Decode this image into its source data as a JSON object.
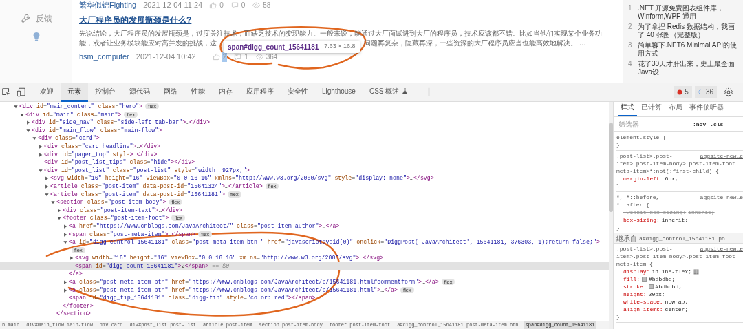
{
  "page": {
    "sidebar": {
      "items": [
        {
          "kind": "wrench",
          "label": "反馈"
        },
        {
          "kind": "bulb"
        }
      ]
    },
    "posts": [
      {
        "author": "繁华似锦Fighting",
        "date": "2021-12-04 11:24",
        "likes": "0",
        "comments": "0",
        "views": "58",
        "inspected": false
      },
      {
        "title": "大厂程序员的发展瓶颈是什么?",
        "excerpt_lines": [
          [
            "先说结论，大厂程序员的发展瓶颈是，过度关注技术，而缺乏技术的变现能力。一般来说，能通过大厂面试进到大厂的程序员，技术应该都不错。比如当他们实现某个业务功"
          ],
          [
            "能，或者让业务模块能应对高并发的挑战，这",
            "问题再复杂，隐藏再深，一些资深的大厂程序员应当也能高效地解决。 …"
          ]
        ],
        "author": "hsm_computer",
        "date": "2021-12-04 10:42",
        "likes": "2",
        "comments": "1",
        "views": "364",
        "inspected": true
      }
    ],
    "tooltip": {
      "selector": "span#digg_count_15641181",
      "size": "7.63 × 16.8"
    },
    "ranking": [
      {
        "rank": "1",
        "title": ".NET 开源免费图表组件库，Winform,WPF 通用"
      },
      {
        "rank": "2",
        "title": "为了拿捏 Redis 数据结构，我画了 40 张图（完整版）"
      },
      {
        "rank": "3",
        "title": "简单聊下.NET6 Minimal API的使用方式"
      },
      {
        "rank": "4",
        "title": "花了30天才肝出来，史上最全面Java设"
      }
    ]
  },
  "devtools": {
    "tabs": [
      {
        "label": "欢迎",
        "selected": false,
        "experimental": false
      },
      {
        "label": "元素",
        "selected": true,
        "experimental": false
      },
      {
        "label": "控制台",
        "selected": false,
        "experimental": false
      },
      {
        "label": "源代码",
        "selected": false,
        "experimental": false
      },
      {
        "label": "网络",
        "selected": false,
        "experimental": false
      },
      {
        "label": "性能",
        "selected": false,
        "experimental": false
      },
      {
        "label": "内存",
        "selected": false,
        "experimental": false
      },
      {
        "label": "应用程序",
        "selected": false,
        "experimental": false
      },
      {
        "label": "安全性",
        "selected": false,
        "experimental": false
      },
      {
        "label": "Lighthouse",
        "selected": false,
        "experimental": false
      },
      {
        "label": "CSS 概述",
        "selected": false,
        "experimental": true
      }
    ],
    "errors": "5",
    "messages": "36",
    "tree": [
      {
        "text": "<div id=\"main_content\" class=\"hero\">",
        "expanded": true,
        "badge": "flex",
        "children": [
          {
            "text": "<div id=\"main\" class=\"main\">",
            "expanded": true,
            "badge": "flex",
            "children": [
              {
                "text": "<div id=\"side_nav\" class=\"side-left tab-bar\">…</div>",
                "expanded": false
              },
              {
                "text": "<div id=\"main_flow\" class=\"main-flow\">",
                "expanded": true,
                "children": [
                  {
                    "text": "<div class=\"card\">",
                    "expanded": true,
                    "children": [
                      {
                        "text": "<div class=\"card headline\">…</div>",
                        "expanded": false
                      },
                      {
                        "text": "<div id=\"pager_top\" style>…</div>",
                        "expanded": false
                      },
                      {
                        "text": "<div id=\"post_list_tips\" class=\"hide\"></div>"
                      },
                      {
                        "text": "<div id=\"post_list\" class=\"post-list\" style=\"width: 927px;\">",
                        "expanded": true,
                        "children": [
                          {
                            "text": "<svg width=\"16\" height=\"16\" viewBox=\"0 0 16 16\" xmlns=\"http://www.w3.org/2000/svg\" style=\"display: none\">…</svg>",
                            "expanded": false
                          },
                          {
                            "text": "<article class=\"post-item\" data-post-id=\"15641324\">…</article>",
                            "expanded": false,
                            "badge": "flex"
                          },
                          {
                            "text": "<article class=\"post-item\" data-post-id=\"15641181\">",
                            "expanded": true,
                            "badge": "flex",
                            "children": [
                              {
                                "text": "<section class=\"post-item-body\">",
                                "expanded": true,
                                "badge": "flex",
                                "close": "</section>",
                                "children": [
                                  {
                                    "text": "<div class=\"post-item-text\">…</div>",
                                    "expanded": false
                                  },
                                  {
                                    "text": "<footer class=\"post-item-foot\">",
                                    "expanded": true,
                                    "badge": "flex",
                                    "close": "</footer>",
                                    "children": [
                                      {
                                        "text": "<a href=\"https://www.cnblogs.com/JavaArchitect/\" class=\"post-item-author\">…</a>",
                                        "expanded": false
                                      },
                                      {
                                        "text": "<span class=\"post-meta-item\">…</span>",
                                        "expanded": false,
                                        "badge": "flex"
                                      },
                                      {
                                        "text": "<a id=\"digg_control_15641181\" class=\"post-meta-item btn \" href=\"javascript:void(0)\" onclick=\"DiggPost('JavaArchitect', 15641181, 376303, 1);return false;\">",
                                        "expanded": true,
                                        "badge": "flex",
                                        "close": "</a>",
                                        "children": [
                                          {
                                            "text": "<svg width=\"16\" height=\"16\" viewBox=\"0 0 16 16\" xmlns=\"http://www.w3.org/2000/svg\">…</svg>",
                                            "expanded": false
                                          },
                                          {
                                            "text": "<span id=\"digg_count_15641181\">2</span>",
                                            "selected": true,
                                            "suffix": "== $0"
                                          }
                                        ]
                                      },
                                      {
                                        "text": "<a class=\"post-meta-item btn\" href=\"https://www.cnblogs.com/JavaArchitect/p/15641181.html#commentform\">…</a>",
                                        "expanded": false,
                                        "badge": "flex"
                                      },
                                      {
                                        "text": "<a class=\"post-meta-item btn\" href=\"https://www.cnblogs.com/JavaArchitect/p/15641181.html\">…</a>",
                                        "expanded": false,
                                        "badge": "flex"
                                      },
                                      {
                                        "text": "<span id=\"digg_tip_15641181\" class=\"digg-tip\" style=\"color: red\"></span>"
                                      }
                                    ]
                                  }
                                ]
                              }
                            ]
                          }
                        ]
                      }
                    ]
                  }
                ]
              }
            ]
          }
        ]
      }
    ],
    "breadcrumbs": [
      {
        "label": "n.main",
        "selected": false
      },
      {
        "label": "div#main_flow.main-flow",
        "selected": false
      },
      {
        "label": "div.card",
        "selected": false
      },
      {
        "label": "div#post_list.post-list",
        "selected": false
      },
      {
        "label": "article.post-item",
        "selected": false
      },
      {
        "label": "section.post-item-body",
        "selected": false
      },
      {
        "label": "footer.post-item-foot",
        "selected": false
      },
      {
        "label": "a#digg_control_15641181.post-meta-item.btn",
        "selected": false
      },
      {
        "label": "span#digg_count_15641181",
        "selected": true
      }
    ],
    "styles": {
      "tabs": [
        {
          "label": "样式",
          "selected": true
        },
        {
          "label": "已计算",
          "selected": false
        },
        {
          "label": "布局",
          "selected": false
        },
        {
          "label": "事件侦听器",
          "selected": false
        }
      ],
      "filter": {
        "placeholder": "筛选器"
      },
      "buttons": [
        ":hov",
        ".cls"
      ],
      "rules": [
        {
          "kind": "rule",
          "selector": [
            "element.style {"
          ],
          "close": "}"
        },
        {
          "kind": "rule",
          "selector": [
            ".post-list>.post-",
            "item>.post-item-body>.post-item-foot",
            "meta-item>*:not(:first-child) {"
          ],
          "source": "aggsite-new…e",
          "declarations": [
            {
              "property": "margin-left:",
              "value": "6px;",
              "struck": false
            }
          ],
          "close": "}"
        },
        {
          "kind": "rule",
          "selector": [
            "*, *::before,",
            "*::after {"
          ],
          "source": "aggsite-new…e",
          "declarations": [
            {
              "property": "-webkit-box-sizing:",
              "value": "inherit;",
              "struck": true
            },
            {
              "property": "box-sizing:",
              "value": "inherit;",
              "struck": false
            }
          ],
          "close": "}"
        },
        {
          "kind": "inherited",
          "label": "继承自",
          "selector": [
            "a#digg_control_15641181.po…"
          ]
        },
        {
          "kind": "rule",
          "selector": [
            ".post-list>.post-",
            "item>.post-item-body>.post-item-foot",
            "meta-item {"
          ],
          "source": "aggsite-new…e",
          "declarations": [
            {
              "property": "display:",
              "value": "inline-flex;",
              "struck": false,
              "flex_editor": true
            },
            {
              "property": "fill:",
              "value": "#bdbdbd;",
              "struck": false,
              "color": "#bdbdbd"
            },
            {
              "property": "stroke:",
              "value": "#bdbdbd;",
              "struck": false,
              "color": "#bdbdbd"
            },
            {
              "property": "height:",
              "value": "20px;",
              "struck": false
            },
            {
              "property": "white-space:",
              "value": "nowrap;",
              "struck": false
            },
            {
              "property": "align-items:",
              "value": "center;",
              "struck": false
            }
          ],
          "close": "}"
        }
      ]
    }
  }
}
